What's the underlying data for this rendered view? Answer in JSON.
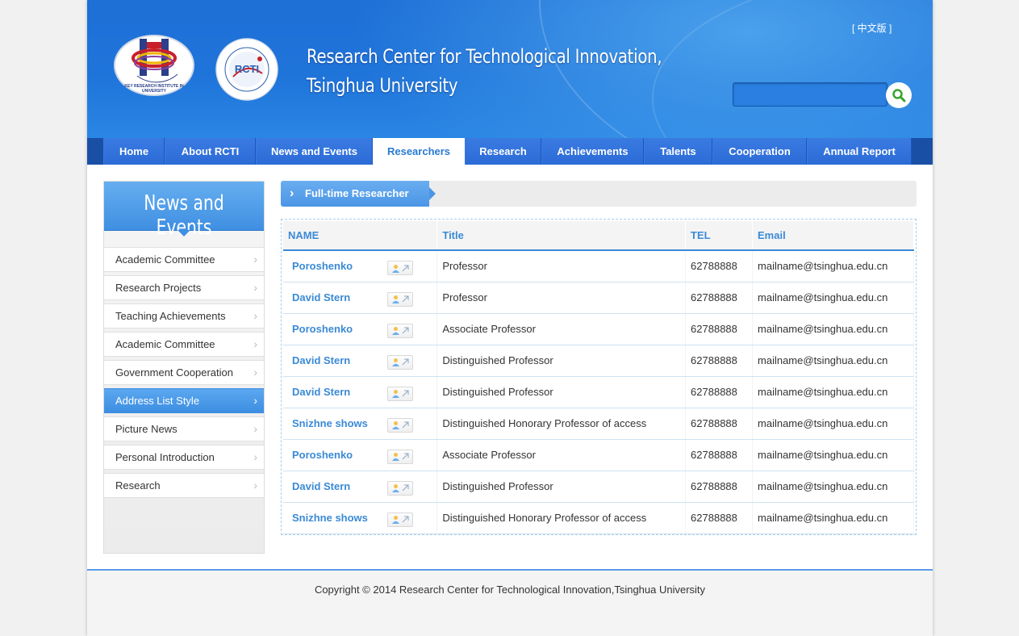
{
  "header": {
    "title_line1": "Research Center for Technological Innovation,",
    "title_line2": "Tsinghua University",
    "lang_switch": "[ 中文版 ]",
    "search_placeholder": "",
    "logo1_text": "KEY RESEARCH INSTITUTE IN UNIVERSITY",
    "logo2_text": "RCTI",
    "logo2_ring_text": "Research Center for Technological Innovation Tsinghua University"
  },
  "nav": {
    "items": [
      {
        "label": "Home"
      },
      {
        "label": "About RCTI"
      },
      {
        "label": "News and Events"
      },
      {
        "label": "Researchers"
      },
      {
        "label": "Research"
      },
      {
        "label": "Achievements"
      },
      {
        "label": "Talents"
      },
      {
        "label": "Cooperation"
      },
      {
        "label": "Annual Report"
      }
    ],
    "active": "Researchers"
  },
  "sidebar": {
    "title": "News and Events",
    "items": [
      {
        "label": "Academic Committee"
      },
      {
        "label": "Research Projects"
      },
      {
        "label": "Teaching Achievements"
      },
      {
        "label": "Academic Committee"
      },
      {
        "label": "Government Cooperation"
      },
      {
        "label": "Address List Style"
      },
      {
        "label": "Picture News"
      },
      {
        "label": "Personal Introduction"
      },
      {
        "label": "Research"
      }
    ],
    "active": "Address List Style"
  },
  "content": {
    "section_title": "Full-time Researcher",
    "columns": [
      "NAME",
      "Title",
      "TEL",
      "Email"
    ],
    "rows": [
      {
        "name": "Poroshenko",
        "title": "Professor",
        "tel": "62788888",
        "email": "mailname@tsinghua.edu.cn"
      },
      {
        "name": "David Stern",
        "title": "Professor",
        "tel": "62788888",
        "email": "mailname@tsinghua.edu.cn"
      },
      {
        "name": "Poroshenko",
        "title": "Associate Professor",
        "tel": "62788888",
        "email": "mailname@tsinghua.edu.cn"
      },
      {
        "name": "David Stern",
        "title": "Distinguished Professor",
        "tel": "62788888",
        "email": "mailname@tsinghua.edu.cn"
      },
      {
        "name": "David Stern",
        "title": "Distinguished Professor",
        "tel": "62788888",
        "email": "mailname@tsinghua.edu.cn"
      },
      {
        "name": "Snizhne shows",
        "title": "Distinguished Honorary Professor of access",
        "tel": "62788888",
        "email": "mailname@tsinghua.edu.cn"
      },
      {
        "name": "Poroshenko",
        "title": "Associate Professor",
        "tel": "62788888",
        "email": "mailname@tsinghua.edu.cn"
      },
      {
        "name": "David Stern",
        "title": "Distinguished Professor",
        "tel": "62788888",
        "email": "mailname@tsinghua.edu.cn"
      },
      {
        "name": "Snizhne shows",
        "title": "Distinguished Honorary Professor of access",
        "tel": "62788888",
        "email": "mailname@tsinghua.edu.cn"
      }
    ]
  },
  "footer": {
    "copyright": "Copyright © 2014 Research Center for Technological Innovation,Tsinghua University"
  },
  "colors": {
    "brand_blue": "#1f74da",
    "accent_blue": "#3a8ad6",
    "nav_bg": "#2c6bd6"
  }
}
